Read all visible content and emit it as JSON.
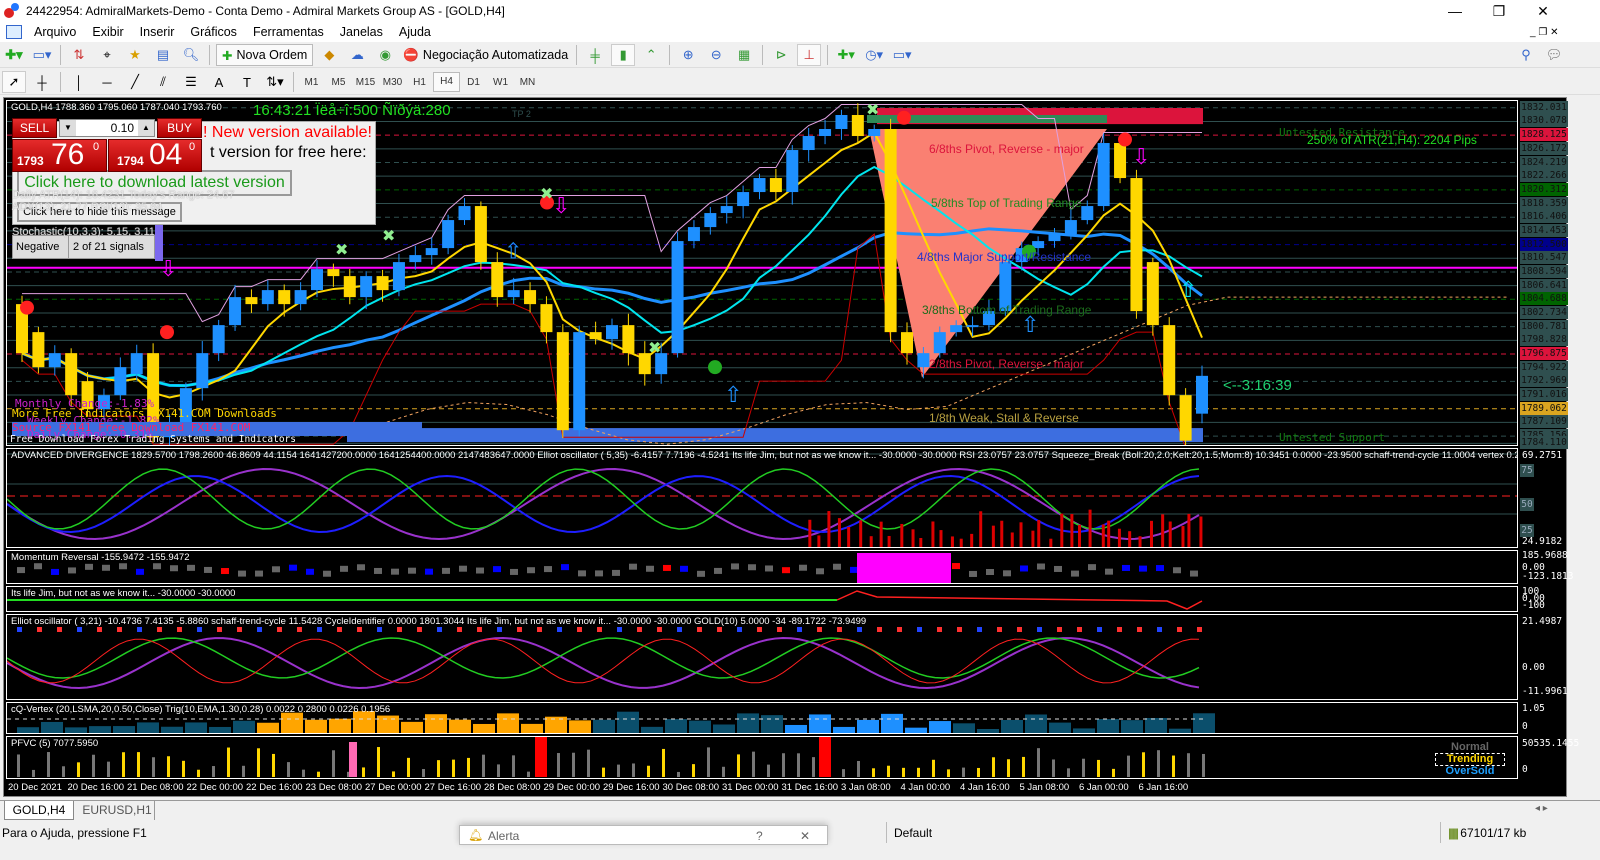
{
  "window": {
    "title": "24422954: AdmiralMarkets-Demo - Conta Demo - Admiral Markets Group AS - [GOLD,H4]",
    "minimize": "—",
    "maximize": "❐",
    "close": "✕"
  },
  "menu": [
    "Arquivo",
    "Exibir",
    "Inserir",
    "Gráficos",
    "Ferramentas",
    "Janelas",
    "Ajuda"
  ],
  "toolbar": {
    "new_order": "Nova Ordem",
    "auto_trading": "Negociação Automatizada",
    "timeframes": [
      "M1",
      "M5",
      "M15",
      "M30",
      "H1",
      "H4",
      "D1",
      "W1",
      "MN"
    ],
    "active_timeframe": "H4"
  },
  "chart": {
    "symbol_info": "GOLD,H4  1788.360 1795.060 1787.040 1793.760",
    "clock_text": "16:43:21 Ïëå÷î:500 Ñïðýä:280",
    "tp_label": "TP 2",
    "one_click": {
      "sell": "SELL",
      "buy": "BUY",
      "lot": "0.10",
      "sell_big": "1793",
      "sell_pips": "76",
      "sell_sup": "0",
      "buy_big": "1794",
      "buy_pips": "04",
      "buy_sup": "0"
    },
    "popup": {
      "line1": "! New version available!",
      "line2": "t version for free here:",
      "download": "Click here to download latest version",
      "hide": "Click here to hide this message",
      "overlay_lines": [
        "Daily ATR(14): 16.4231 Today's Range: 24.67",
        "ADX(13): 21.77 RSI(13): 35.84",
        "Stochastic(10,3,3): 5.15, 3.11"
      ],
      "signal_state": "Negative",
      "signal_count": "2 of 21 signals"
    },
    "changes": {
      "monthly": "Monthly Change:-1.83%",
      "weekly": "Weekly Change:-1.82%",
      "daily": "Daily Change:-0.31%"
    },
    "ads": [
      "More Free Indicators FX141.COM Downloads",
      "Source FX141 Free Download FX141.COM",
      "Free Download Forex Trading Systems and Indicators"
    ],
    "murray": {
      "m6": "6/8ths Pivot, Reverse - major",
      "m5": "5/8ths Top of Trading Range",
      "m4": "4/8ths Major Support/Resistance",
      "m3": "3/8ths Bottom of Trading Range",
      "m2": "2/8ths Pivot, Reverse - major",
      "m1": "1/8th Weak, Stall & Reverse"
    },
    "untested_resistance": "Untested Resistance",
    "untested_support": "Untested Support",
    "atr_text": "250% of ATR(21,H4): 2204  Pips",
    "countdown": "<--3:16:39",
    "price_min": 1784.11,
    "price_max": 1832.031,
    "price_labels": [
      "1832.031",
      "1830.078",
      "1828.125",
      "1826.172",
      "1824.219",
      "1822.266",
      "1820.312",
      "1818.359",
      "1816.406",
      "1814.453",
      "1812.500",
      "1810.547",
      "1808.594",
      "1806.641",
      "1804.688",
      "1802.734",
      "1800.781",
      "1798.828",
      "1796.875",
      "1794.922",
      "1792.969",
      "1791.016",
      "1789.062",
      "1787.109",
      "1785.156",
      "1784.110"
    ],
    "highlighted_prices": {
      "1828.125": "#dc143c",
      "1820.312": "#006400",
      "1812.500": "#00008b",
      "1804.688": "#006400",
      "1796.875": "#dc143c",
      "1789.062": "#daa520"
    },
    "candles": [
      [
        1804,
        1797
      ],
      [
        1800,
        1795
      ],
      [
        1795,
        1797
      ],
      [
        1797,
        1791
      ],
      [
        1793,
        1789
      ],
      [
        1789,
        1791
      ],
      [
        1791,
        1795
      ],
      [
        1794,
        1797
      ],
      [
        1797,
        1785
      ],
      [
        1785,
        1787
      ],
      [
        1787,
        1792
      ],
      [
        1792,
        1797
      ],
      [
        1797,
        1801
      ],
      [
        1801,
        1805
      ],
      [
        1805,
        1804
      ],
      [
        1804,
        1806
      ],
      [
        1806,
        1804
      ],
      [
        1804,
        1806
      ],
      [
        1806,
        1809
      ],
      [
        1809,
        1808
      ],
      [
        1808,
        1805
      ],
      [
        1805,
        1808
      ],
      [
        1808,
        1806
      ],
      [
        1806,
        1810
      ],
      [
        1810,
        1811
      ],
      [
        1811,
        1812
      ],
      [
        1812,
        1816
      ],
      [
        1816,
        1818
      ],
      [
        1818,
        1810
      ],
      [
        1810,
        1805
      ],
      [
        1805,
        1806
      ],
      [
        1806,
        1804
      ],
      [
        1804,
        1800
      ],
      [
        1800,
        1786
      ],
      [
        1786,
        1800
      ],
      [
        1800,
        1799
      ],
      [
        1799,
        1801
      ],
      [
        1801,
        1797
      ],
      [
        1797,
        1794
      ],
      [
        1794,
        1797
      ],
      [
        1797,
        1813
      ],
      [
        1813,
        1815
      ],
      [
        1815,
        1817
      ],
      [
        1817,
        1818
      ],
      [
        1818,
        1820
      ],
      [
        1820,
        1822
      ],
      [
        1822,
        1820
      ],
      [
        1820,
        1826
      ],
      [
        1826,
        1828
      ],
      [
        1828,
        1829
      ],
      [
        1829,
        1831
      ],
      [
        1831,
        1828
      ],
      [
        1828,
        1829
      ],
      [
        1829,
        1800
      ],
      [
        1800,
        1797
      ],
      [
        1795,
        1797
      ],
      [
        1797,
        1800
      ],
      [
        1800,
        1801
      ],
      [
        1801,
        1801
      ],
      [
        1801,
        1803
      ],
      [
        1803,
        1810
      ],
      [
        1810,
        1812
      ],
      [
        1812,
        1813
      ],
      [
        1813,
        1814
      ],
      [
        1814,
        1816
      ],
      [
        1816,
        1818
      ],
      [
        1818,
        1827
      ],
      [
        1827,
        1822
      ],
      [
        1822,
        1803
      ],
      [
        1810,
        1801
      ],
      [
        1801,
        1791
      ],
      [
        1791,
        1784.5
      ],
      [
        1788.36,
        1793.76
      ]
    ],
    "colors": {
      "bull": "#1e90ff",
      "bear": "#ffd700",
      "bg": "#000000"
    }
  },
  "subwindows": {
    "divergence": {
      "title": "ADVANCED DIVERGENCE 1829.5700 1798.2600 46.8609 44.1154 1641427200.0000 1641254400.0000 2147483647.0000  Elliot oscillator ( 5,35) -6.4157 7.7196 -4.5241  Its life Jim, but not as we know it... -30.0000 -30.0000  RSI 23.0757 23.0757  Squeeze_Break (Boll:20,2.0;Kelt:20,1.5;Mom:8) 10.3451 0.0000 -23.9500  schaff-trend-cycle 11.0004  vertex 0.2500 0.0",
      "axis": [
        "69.2751",
        "75",
        "50",
        "25",
        "24.9182"
      ]
    },
    "momentum": {
      "title": "Momentum Reversal -155.9472 -155.9472",
      "axis": [
        "185.9688",
        "0.00",
        "-123.1813"
      ]
    },
    "jim": {
      "title": "Its life Jim, but not as we know it... -30.0000 -30.0000",
      "axis": [
        "100",
        "0.00",
        "-100"
      ]
    },
    "elliot": {
      "title": "Elliot oscillator ( 3,21) -10.4736 7.4135 -5.8860  schaff-trend-cycle 11.5428  CycleIdentifier 0.0000 1801.3044  Its life Jim, but not as we know it... -30.0000 -30.0000  GOLD(10) 5.0000 -34 -89.1722 -73.9499",
      "axis": [
        "21.4987",
        "0.00",
        "-11.9961"
      ]
    },
    "vertex": {
      "title": "cQ-Vertex (20,LSMA,20,0.50,Close) Trig(10,EMA,1.30,0.28)  0.0022 0.2800 0.0226 0.1956",
      "axis": [
        "1.05",
        "0"
      ]
    },
    "pfvc": {
      "title": "PFVC (5) 7077.5950",
      "axis": [
        "50535.1455",
        "0"
      ],
      "legend": [
        "Normal",
        "Trending",
        "OverSold"
      ]
    }
  },
  "time_labels": [
    "20 Dec 2021",
    "20 Dec 16:00",
    "21 Dec 08:00",
    "22 Dec 00:00",
    "22 Dec 16:00",
    "23 Dec 08:00",
    "27 Dec 00:00",
    "27 Dec 16:00",
    "28 Dec 08:00",
    "29 Dec 00:00",
    "29 Dec 16:00",
    "30 Dec 08:00",
    "31 Dec 00:00",
    "31 Dec 16:00",
    "3 Jan 08:00",
    "4 Jan 00:00",
    "4 Jan 16:00",
    "5 Jan 08:00",
    "6 Jan 00:00",
    "6 Jan 16:00"
  ],
  "tabs": [
    {
      "label": "GOLD,H4",
      "active": true
    },
    {
      "label": "EURUSD,H1",
      "active": false
    }
  ],
  "status": {
    "help": "Para o Ajuda, pressione F1",
    "alert": "Alerta",
    "alert_help": "?",
    "alert_close": "✕",
    "profile": "Default",
    "traffic": "67101/17 kb"
  }
}
